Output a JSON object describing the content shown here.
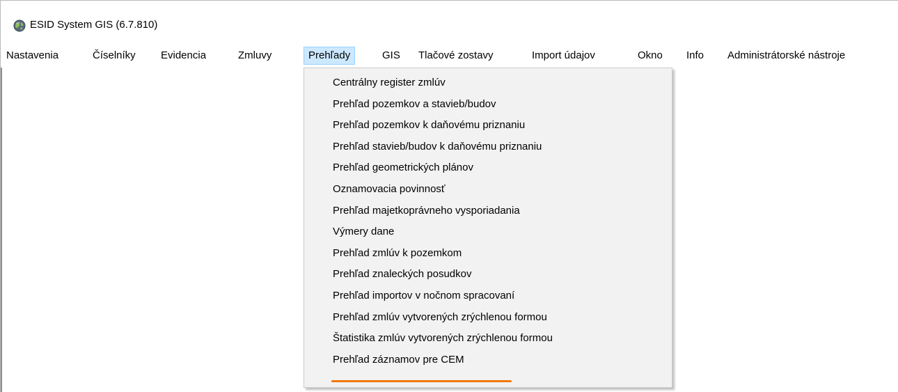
{
  "window": {
    "title": "ESID System GIS (6.7.810)",
    "app_icon": "globe-icon"
  },
  "menubar": {
    "items": [
      {
        "label": "Nastavenia",
        "active": false
      },
      {
        "label": "Číselníky",
        "active": false
      },
      {
        "label": "Evidencia",
        "active": false
      },
      {
        "label": "Zmluvy",
        "active": false
      },
      {
        "label": "Prehľady",
        "active": true
      },
      {
        "label": "GIS",
        "active": false
      },
      {
        "label": "Tlačové zostavy",
        "active": false
      },
      {
        "label": "Import údajov",
        "active": false
      },
      {
        "label": "Okno",
        "active": false
      },
      {
        "label": "Info",
        "active": false
      },
      {
        "label": "Administrátorské nástroje",
        "active": false
      }
    ]
  },
  "dropdown": {
    "items": [
      {
        "label": "Centrálny register zmlúv"
      },
      {
        "label": "Prehľad pozemkov a stavieb/budov"
      },
      {
        "label": "Prehľad pozemkov k daňovému priznaniu"
      },
      {
        "label": "Prehľad stavieb/budov k daňovému priznaniu"
      },
      {
        "label": "Prehľad geometrických plánov"
      },
      {
        "label": "Oznamovacia povinnosť"
      },
      {
        "label": "Prehľad majetkoprávneho vysporiadania"
      },
      {
        "label": "Výmery dane"
      },
      {
        "label": "Prehľad zmlúv k pozemkom"
      },
      {
        "label": "Prehľad znaleckých posudkov"
      },
      {
        "label": "Prehľad importov v nočnom spracovaní"
      },
      {
        "label": "Prehľad zmlúv vytvorených zrýchlenou formou"
      },
      {
        "label": "Štatistika zmlúv vytvorených zrýchlenou formou"
      },
      {
        "label": "Prehľad záznamov pre CEM",
        "highlighted": true
      }
    ]
  },
  "colors": {
    "menu_active_bg": "#cce8ff",
    "menu_active_border": "#99d1ff",
    "dropdown_bg": "#f2f2f2",
    "highlight_underline": "#f07800"
  }
}
